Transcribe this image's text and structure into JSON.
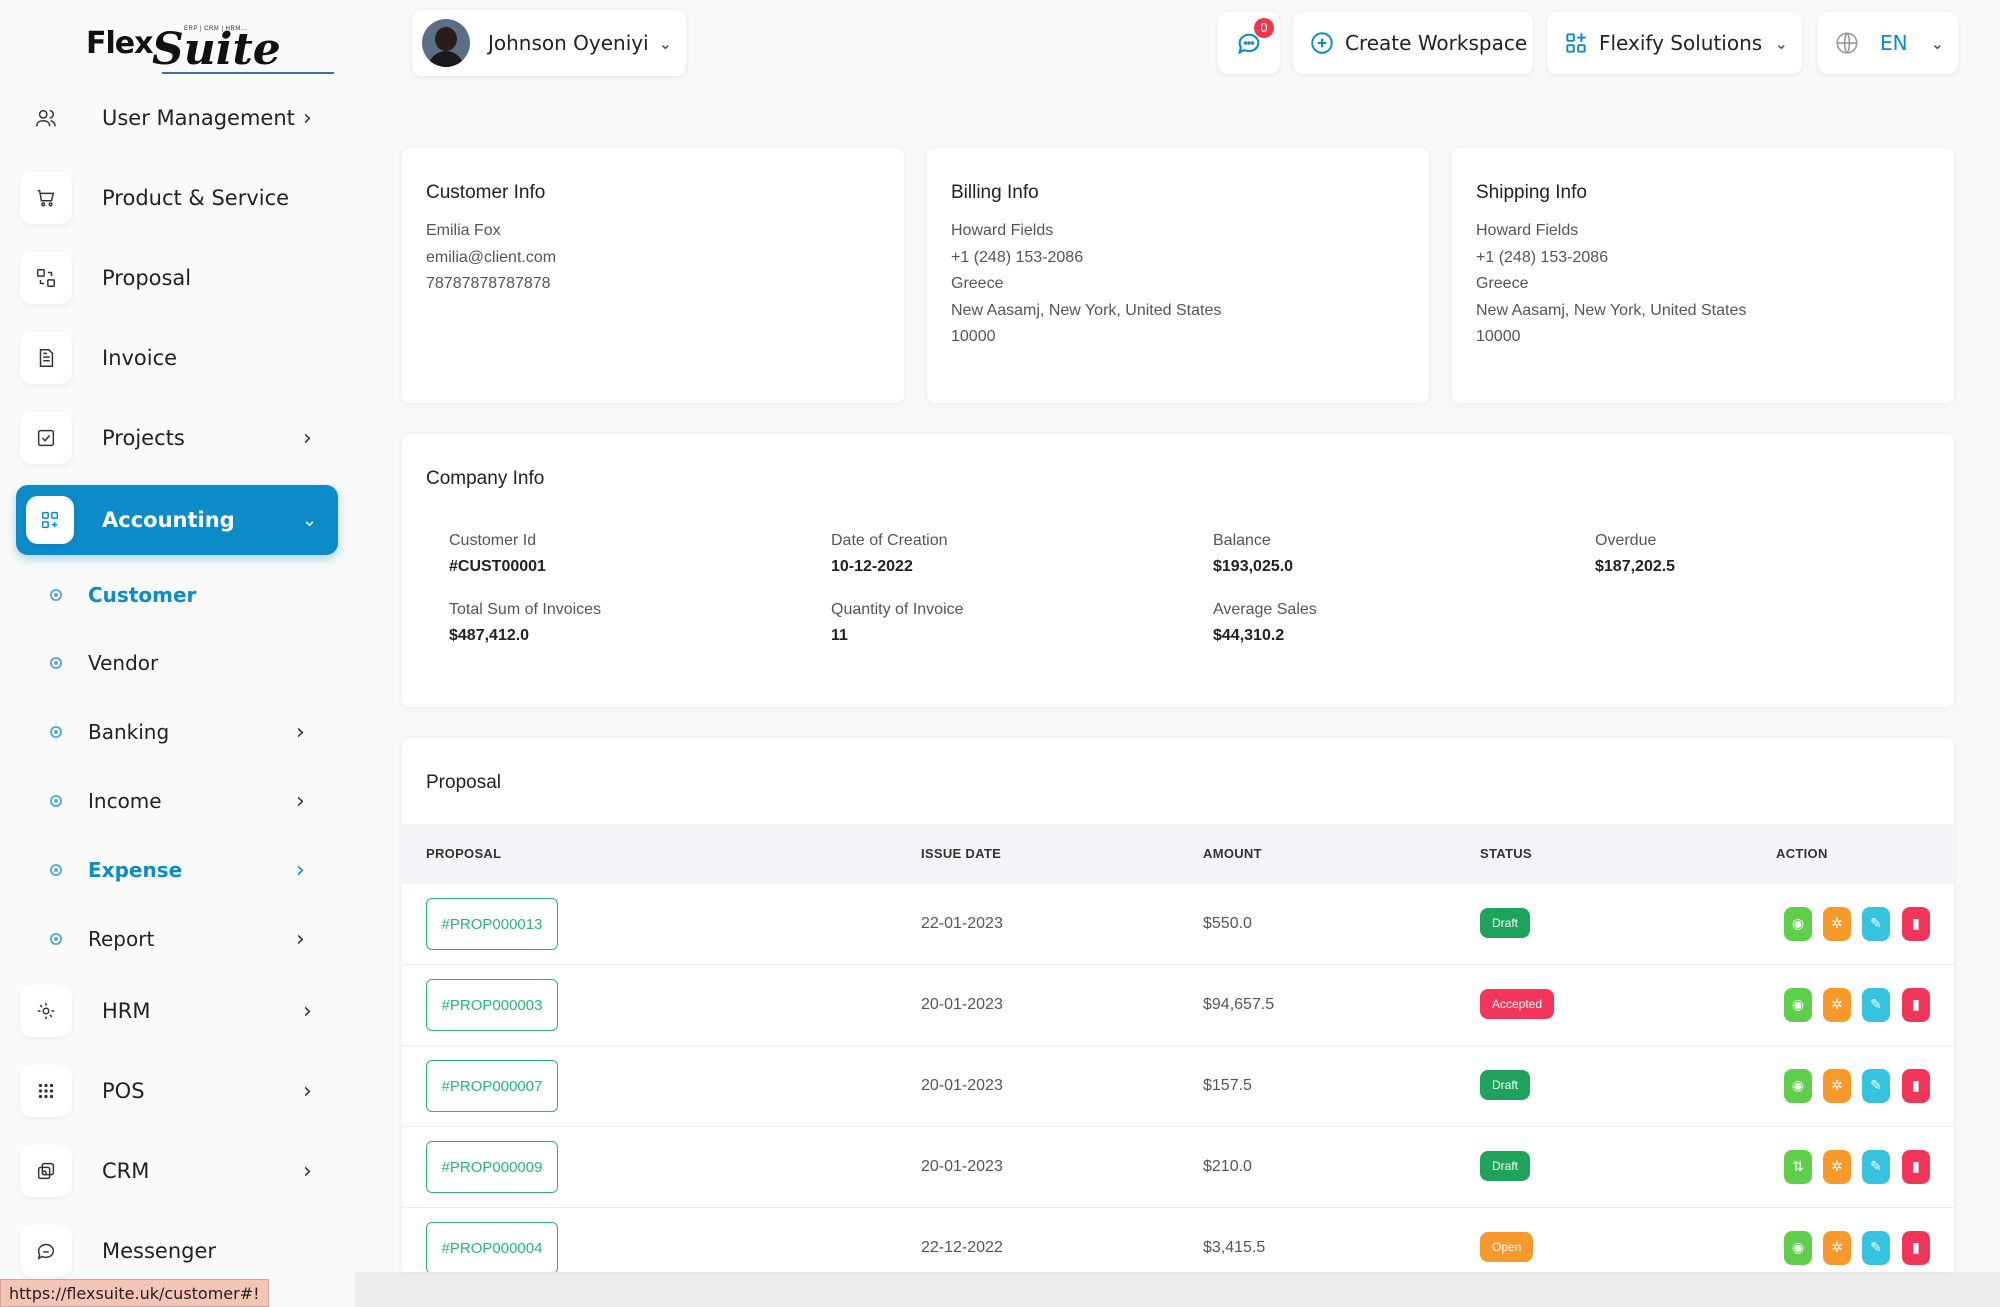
{
  "brand": {
    "name_part1": "Flex",
    "name_part2": "Suite",
    "tagline": "ERP | CRM | HRM..."
  },
  "header": {
    "user_name": "Johnson Oyeniyi",
    "notification_count": "0",
    "create_workspace_label": "Create Workspace",
    "workspace_name": "Flexify Solutions",
    "language": "EN"
  },
  "sidebar": {
    "items": [
      {
        "label": "User Management",
        "icon": "users-icon",
        "has_chevron": true
      },
      {
        "label": "Product & Service",
        "icon": "cart-icon",
        "has_chevron": false
      },
      {
        "label": "Proposal",
        "icon": "proposal-icon",
        "has_chevron": false
      },
      {
        "label": "Invoice",
        "icon": "invoice-icon",
        "has_chevron": false
      },
      {
        "label": "Projects",
        "icon": "projects-icon",
        "has_chevron": true
      },
      {
        "label": "Accounting",
        "icon": "grid-plus-icon",
        "active": true
      },
      {
        "label": "HRM",
        "icon": "hrm-icon",
        "has_chevron": true
      },
      {
        "label": "POS",
        "icon": "dots-grid-icon",
        "has_chevron": true
      },
      {
        "label": "CRM",
        "icon": "crm-icon",
        "has_chevron": true
      },
      {
        "label": "Messenger",
        "icon": "chat-icon",
        "has_chevron": false
      }
    ],
    "accounting_sub": [
      {
        "label": "Customer",
        "active": true
      },
      {
        "label": "Vendor"
      },
      {
        "label": "Banking"
      },
      {
        "label": "Income"
      },
      {
        "label": "Expense"
      },
      {
        "label": "Report"
      }
    ]
  },
  "customer_info": {
    "title": "Customer Info",
    "name": "Emilia Fox",
    "email": "emilia@client.com",
    "phone": "78787878787878"
  },
  "billing_info": {
    "title": "Billing Info",
    "name": "Howard Fields",
    "phone": "+1 (248) 153-2086",
    "country": "Greece",
    "address": "New Aasamj, New York, United States",
    "zip": "10000"
  },
  "shipping_info": {
    "title": "Shipping Info",
    "name": "Howard Fields",
    "phone": "+1 (248) 153-2086",
    "country": "Greece",
    "address": "New Aasamj, New York, United States",
    "zip": "10000"
  },
  "company_info": {
    "title": "Company Info",
    "fields": [
      {
        "label": "Customer Id",
        "value": "#CUST00001"
      },
      {
        "label": "Date of Creation",
        "value": "10-12-2022"
      },
      {
        "label": "Balance",
        "value": "$193,025.0"
      },
      {
        "label": "Overdue",
        "value": "$187,202.5"
      },
      {
        "label": "Total Sum of Invoices",
        "value": "$487,412.0"
      },
      {
        "label": "Quantity of Invoice",
        "value": "11"
      },
      {
        "label": "Average Sales",
        "value": "$44,310.2"
      }
    ]
  },
  "proposal": {
    "title": "Proposal",
    "columns": [
      "PROPOSAL",
      "ISSUE DATE",
      "AMOUNT",
      "STATUS",
      "ACTION"
    ],
    "rows": [
      {
        "id": "#PROP000013",
        "issue_date": "22-01-2023",
        "amount": "$550.0",
        "status": "Draft",
        "status_color": "#1fa35a"
      },
      {
        "id": "#PROP000003",
        "issue_date": "20-01-2023",
        "amount": "$94,657.5",
        "status": "Accepted",
        "status_color": "#f2365a"
      },
      {
        "id": "#PROP000007",
        "issue_date": "20-01-2023",
        "amount": "$157.5",
        "status": "Draft",
        "status_color": "#1fa35a"
      },
      {
        "id": "#PROP000009",
        "issue_date": "20-01-2023",
        "amount": "$210.0",
        "status": "Draft",
        "status_color": "#1fa35a"
      },
      {
        "id": "#PROP000004",
        "issue_date": "22-12-2022",
        "amount": "$3,415.5",
        "status": "Open",
        "status_color": "#f79a2b"
      }
    ]
  },
  "status_bar": {
    "url": "https://flexsuite.uk/customer#!"
  },
  "colors": {
    "accent": "#0c8bc9",
    "success": "#2bb37a"
  }
}
